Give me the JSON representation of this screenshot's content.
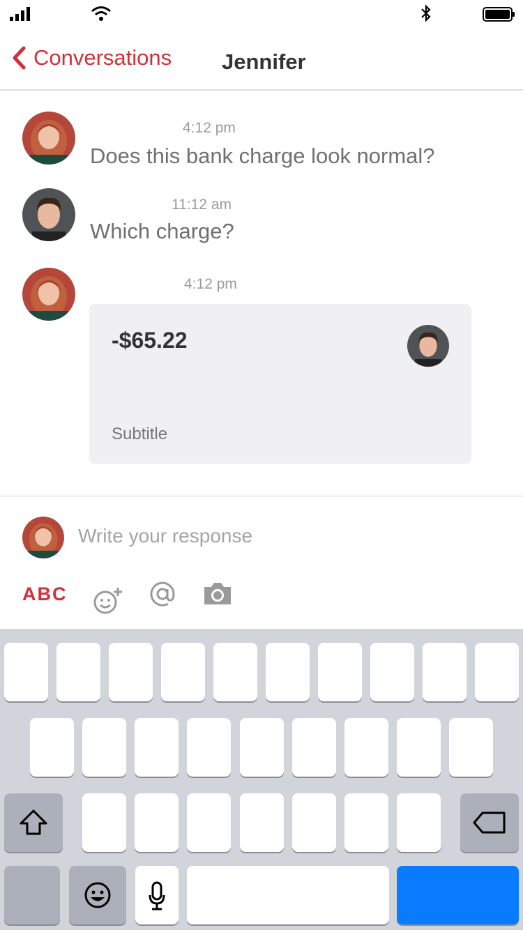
{
  "status_bar": {
    "icons": [
      "signal-icon",
      "wifi-icon",
      "bluetooth-icon",
      "battery-icon"
    ]
  },
  "nav": {
    "back_label": "Conversations",
    "title": "Jennifer"
  },
  "messages": [
    {
      "time": "4:12 pm",
      "text": "Does this bank charge look normal?",
      "sender": "jennifer"
    },
    {
      "time": "11:12 am",
      "text": "Which charge?",
      "sender": "contact"
    },
    {
      "time": "4:12 pm",
      "sender": "jennifer"
    }
  ],
  "card": {
    "amount": "-$65.22",
    "subtitle": "Subtitle"
  },
  "composer": {
    "placeholder": "Write your response",
    "tools": {
      "abc_label": "ABC",
      "icons": [
        "emoji-add-icon",
        "mention-icon",
        "camera-icon"
      ]
    }
  },
  "colors": {
    "accent": "#d32f37",
    "card_bg": "#efeff4",
    "keyboard_bg": "#d1d4da",
    "return_key": "#0a7aff"
  }
}
